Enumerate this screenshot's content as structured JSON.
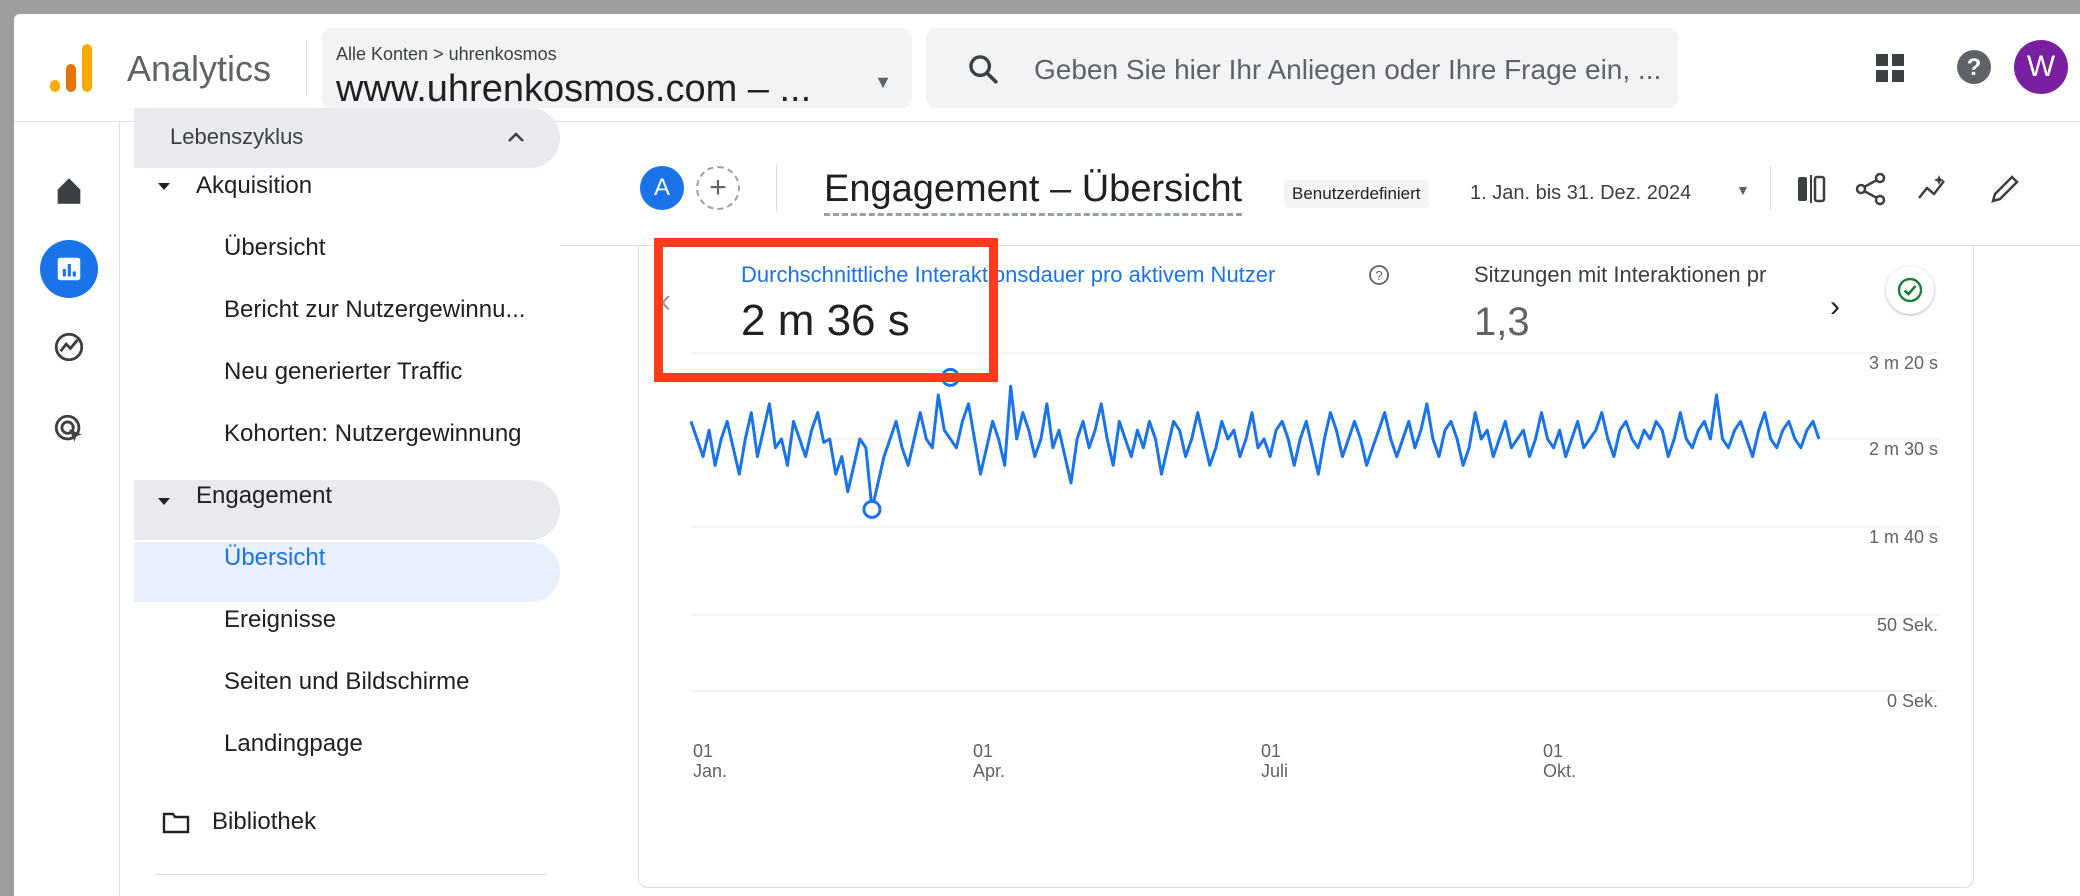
{
  "app": {
    "name": "Analytics"
  },
  "account": {
    "breadcrumb": "Alle Konten > uhrenkosmos",
    "property": "www.uhrenkosmos.com – ..."
  },
  "search": {
    "placeholder": "Geben Sie hier Ihr Anliegen oder Ihre Frage ein, ..."
  },
  "user": {
    "initial": "W"
  },
  "nav": {
    "section": "Lebenszyklus",
    "acquisition": {
      "label": "Akquisition",
      "items": [
        "Übersicht",
        "Bericht zur Nutzergewinnu...",
        "Neu generierter Traffic",
        "Kohorten: Nutzergewinnung"
      ]
    },
    "engagement": {
      "label": "Engagement",
      "items": [
        "Übersicht",
        "Ereignisse",
        "Seiten und Bildschirme",
        "Landingpage"
      ]
    },
    "library": "Bibliothek"
  },
  "header": {
    "property_badge": "A",
    "title": "Engagement – Übersicht",
    "badge": "Benutzerdefiniert",
    "date_range": "1. Jan. bis 31. Dez. 2024"
  },
  "metrics": [
    {
      "label": "Durchschnittliche Interaktionsdauer pro aktivem Nutzer",
      "value": "2 m 36 s"
    },
    {
      "label": "Sitzungen mit Interaktionen pr",
      "value": "1,3"
    }
  ],
  "colors": {
    "accent": "#1a73e8",
    "highlight": "#ff3b1c",
    "avatar": "#7b1fa2"
  },
  "chart_data": {
    "type": "line",
    "title": "",
    "xlabel": "",
    "ylabel": "",
    "y_ticks": [
      "3 m 20 s",
      "2 m 30 s",
      "1 m 40 s",
      "50 Sek.",
      "0 Sek."
    ],
    "x_ticks": [
      {
        "day": "01",
        "month": "Jan."
      },
      {
        "day": "01",
        "month": "Apr."
      },
      {
        "day": "01",
        "month": "Juli"
      },
      {
        "day": "01",
        "month": "Okt."
      }
    ],
    "ylim": [
      0,
      200
    ],
    "series": [
      {
        "values": [
          160,
          150,
          140,
          155,
          135,
          150,
          160,
          145,
          130,
          150,
          165,
          140,
          155,
          170,
          145,
          150,
          135,
          160,
          150,
          140,
          155,
          165,
          148,
          150,
          130,
          140,
          120,
          135,
          150,
          145,
          110,
          125,
          140,
          150,
          160,
          145,
          135,
          150,
          165,
          150,
          145,
          175,
          155,
          150,
          145,
          160,
          170,
          150,
          130,
          145,
          160,
          150,
          135,
          180,
          150,
          165,
          155,
          140,
          150,
          170,
          145,
          155,
          140,
          125,
          150,
          160,
          145,
          155,
          170,
          150,
          135,
          160,
          150,
          140,
          155,
          145,
          160,
          150,
          130,
          145,
          160,
          155,
          140,
          150,
          165,
          150,
          135,
          145,
          160,
          150,
          155,
          140,
          150,
          165,
          145,
          150,
          140,
          155,
          160,
          150,
          135,
          150,
          160,
          145,
          130,
          150,
          165,
          155,
          140,
          150,
          160,
          150,
          135,
          145,
          155,
          165,
          150,
          140,
          150,
          160,
          145,
          155,
          170,
          150,
          140,
          155,
          160,
          150,
          135,
          145,
          165,
          150,
          155,
          140,
          150,
          160,
          145,
          150,
          155,
          140,
          150,
          165,
          150,
          145,
          155,
          140,
          150,
          160,
          145,
          150,
          155,
          165,
          150,
          140,
          155,
          160,
          150,
          145,
          155,
          150,
          160,
          155,
          140,
          150,
          165,
          150,
          145,
          155,
          160,
          150,
          175,
          150,
          145,
          155,
          160,
          150,
          140,
          155,
          165,
          150,
          145,
          155,
          160,
          150,
          145,
          155,
          160,
          150
        ]
      }
    ],
    "markers": [
      {
        "index": 43,
        "value": 185
      },
      {
        "index": 30,
        "value": 110
      }
    ]
  }
}
